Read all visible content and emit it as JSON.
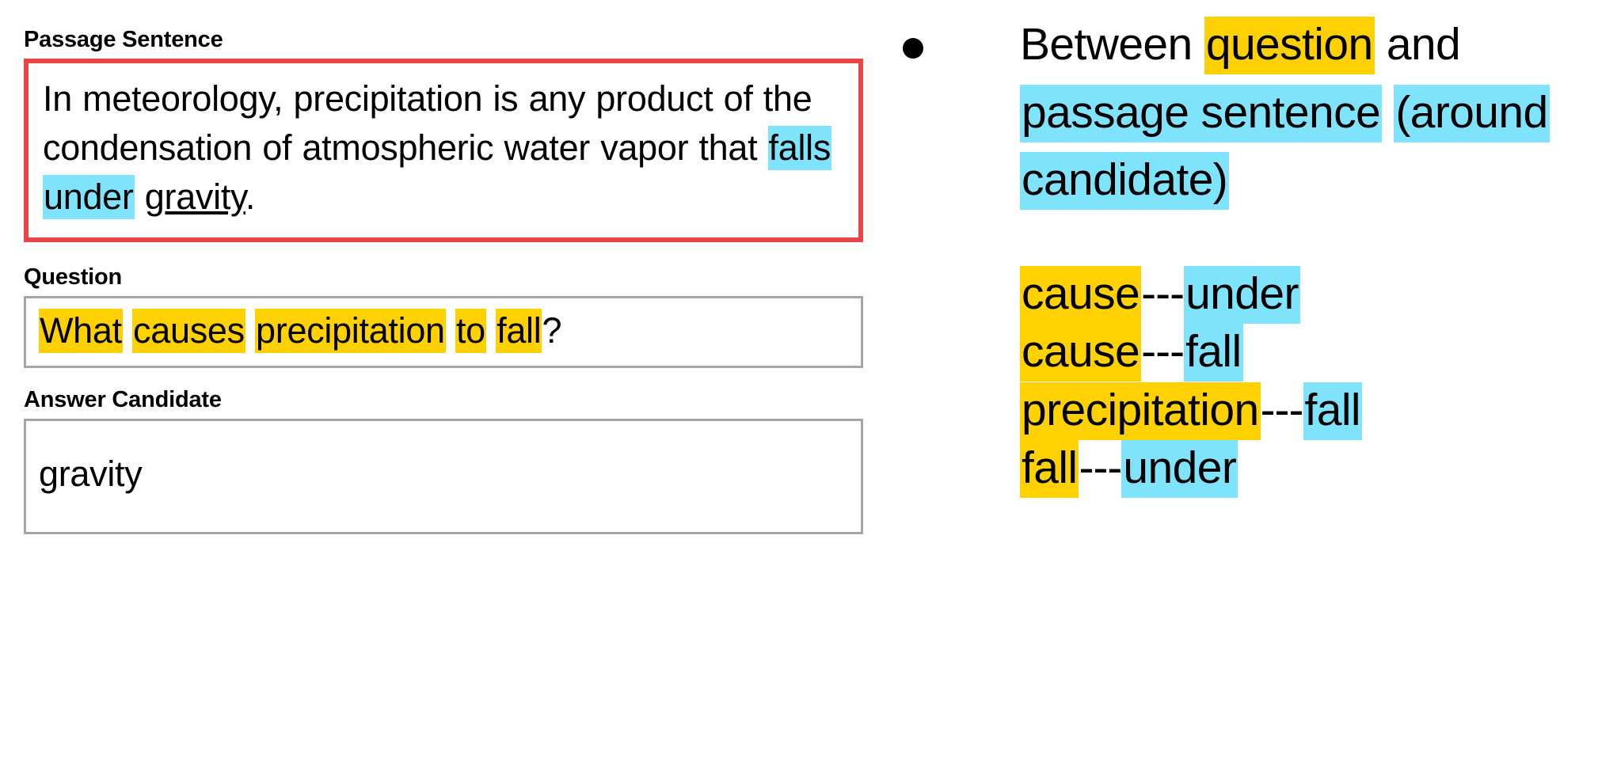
{
  "colors": {
    "highlight_yellow": "#ffd100",
    "highlight_cyan": "#7fe3fb",
    "passage_box_border": "#ea4544",
    "field_box_border": "#a6a6a6",
    "text": "#000000",
    "background": "#ffffff"
  },
  "left_panel": {
    "passage": {
      "label": "Passage Sentence",
      "full_text": "In meteorology, precipitation is any product of the condensation of atmospheric water vapor that falls under gravity.",
      "segments": [
        {
          "text": "In meteorology, precipitation is any product of the condensation of atmospheric water vapor that ",
          "style": "plain"
        },
        {
          "text": "falls",
          "style": "cyan"
        },
        {
          "text": " ",
          "style": "plain"
        },
        {
          "text": "under",
          "style": "cyan"
        },
        {
          "text": " ",
          "style": "plain"
        },
        {
          "text": "gravity",
          "style": "underline"
        },
        {
          "text": ".",
          "style": "plain"
        }
      ]
    },
    "question": {
      "label": "Question",
      "full_text": "What causes precipitation to fall?",
      "segments": [
        {
          "text": "What",
          "style": "yellow"
        },
        {
          "text": " ",
          "style": "plain"
        },
        {
          "text": "causes",
          "style": "yellow"
        },
        {
          "text": " ",
          "style": "plain"
        },
        {
          "text": "precipitation",
          "style": "yellow"
        },
        {
          "text": " ",
          "style": "plain"
        },
        {
          "text": "to",
          "style": "yellow"
        },
        {
          "text": " ",
          "style": "plain"
        },
        {
          "text": "fall",
          "style": "yellow"
        },
        {
          "text": "?",
          "style": "plain"
        }
      ]
    },
    "answer_candidate": {
      "label": "Answer Candidate",
      "value": "gravity"
    }
  },
  "right_panel": {
    "bullet": {
      "marker": "bullet-dot",
      "full_text": "Between question and passage sentence (around candidate)",
      "segments": [
        {
          "text": "Between ",
          "style": "plain"
        },
        {
          "text": "question",
          "style": "yellow"
        },
        {
          "text": " and ",
          "style": "plain"
        },
        {
          "text": "passage sentence",
          "style": "cyan"
        },
        {
          "text": " ",
          "style": "plain"
        },
        {
          "text": "(around candidate)",
          "style": "cyan"
        }
      ]
    },
    "pairs": [
      {
        "left": "cause",
        "separator": "---",
        "right": "under"
      },
      {
        "left": "cause",
        "separator": "---",
        "right": "fall"
      },
      {
        "left": "precipitation",
        "separator": "---",
        "right": "fall"
      },
      {
        "left": "fall",
        "separator": "---",
        "right": "under"
      }
    ]
  }
}
